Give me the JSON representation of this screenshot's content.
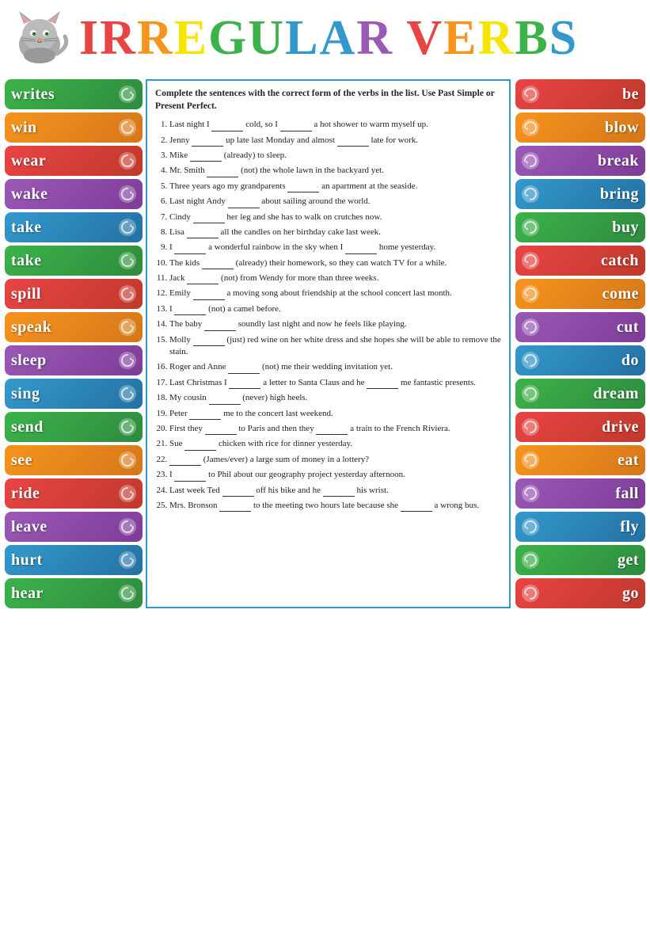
{
  "header": {
    "title": "IRREGULAR VERBS",
    "title_letters": [
      "I",
      "R",
      "R",
      "E",
      "G",
      "U",
      "L",
      "A",
      "R",
      " ",
      "V",
      "E",
      "R",
      "B",
      "S"
    ]
  },
  "instruction": "Complete the sentences with the correct form of the verbs in the list. Use Past Simple or Present Perfect.",
  "sentences": [
    "Last night I _____ cold, so I _____ a hot shower to warm myself up.",
    "Jenny _____ up late last Monday and almost _____ late for work.",
    "Mike _____ (already) to sleep.",
    "Mr. Smith _____ (not) the whole lawn in the backyard yet.",
    "Three years ago my grandparents _____ an apartment at the seaside.",
    "Last night Andy _____ about sailing around the world.",
    "Cindy _____ her leg and she has to walk on crutches now.",
    "Lisa _____ all the candles on her birthday cake last week.",
    "I _____ a wonderful rainbow in the sky when I _____ home yesterday.",
    "The kids _____ (already) their homework, so they can watch TV for a while.",
    "Jack _____ (not) from Wendy for more than three weeks.",
    "Emily _____ a moving song about friendship at the school concert last month.",
    "I _____ (not) a camel before.",
    "The baby _____ soundly last night and now he feels like playing.",
    "Molly _____ (just) red wine on her white dress and she hopes she will be able to remove the stain.",
    "Roger and Anne _____ (not) me their wedding invitation yet.",
    "Last Christmas I _____ a letter to Santa Claus and he _____ me fantastic presents.",
    "My cousin _____ (never) high heels.",
    "Peter _____ me to the concert last weekend.",
    "First they _____ to Paris and then they _____ a train to the French Riviera.",
    "Sue _____ chicken with rice for dinner yesterday.",
    "_____ (James/ever) a large sum of money in a lottery?",
    "I _____ to Phil about our geography project yesterday afternoon.",
    "Last week Ted _____ off his bike and he _____ his wrist.",
    "Mrs. Bronson _____ to the meeting two hours late because she _____ a wrong bus."
  ],
  "left_verbs": [
    {
      "label": "writes",
      "color_class": "vt-writes"
    },
    {
      "label": "win",
      "color_class": "vt-win"
    },
    {
      "label": "wear",
      "color_class": "vt-wear"
    },
    {
      "label": "wake",
      "color_class": "vt-wake"
    },
    {
      "label": "take",
      "color_class": "vt-take1"
    },
    {
      "label": "take",
      "color_class": "vt-take2"
    },
    {
      "label": "spill",
      "color_class": "vt-spill"
    },
    {
      "label": "speak",
      "color_class": "vt-speak"
    },
    {
      "label": "sleep",
      "color_class": "vt-sleep"
    },
    {
      "label": "sing",
      "color_class": "vt-sing"
    },
    {
      "label": "send",
      "color_class": "vt-send"
    },
    {
      "label": "see",
      "color_class": "vt-see"
    },
    {
      "label": "ride",
      "color_class": "vt-ride"
    },
    {
      "label": "leave",
      "color_class": "vt-leave"
    },
    {
      "label": "hurt",
      "color_class": "vt-hurt"
    },
    {
      "label": "hear",
      "color_class": "vt-hear"
    }
  ],
  "right_verbs": [
    {
      "label": "be",
      "color_class": "vt-be"
    },
    {
      "label": "blow",
      "color_class": "vt-blow"
    },
    {
      "label": "break",
      "color_class": "vt-break"
    },
    {
      "label": "bring",
      "color_class": "vt-bring"
    },
    {
      "label": "buy",
      "color_class": "vt-buy"
    },
    {
      "label": "catch",
      "color_class": "vt-catch"
    },
    {
      "label": "come",
      "color_class": "vt-come"
    },
    {
      "label": "cut",
      "color_class": "vt-cut"
    },
    {
      "label": "do",
      "color_class": "vt-do"
    },
    {
      "label": "dream",
      "color_class": "vt-dream"
    },
    {
      "label": "drive",
      "color_class": "vt-drive"
    },
    {
      "label": "eat",
      "color_class": "vt-eat"
    },
    {
      "label": "fall",
      "color_class": "vt-fall"
    },
    {
      "label": "fly",
      "color_class": "vt-fly"
    },
    {
      "label": "get",
      "color_class": "vt-get"
    },
    {
      "label": "go",
      "color_class": "vt-go"
    }
  ],
  "scroll_icon": "🌀",
  "blank_placeholder": "_____"
}
